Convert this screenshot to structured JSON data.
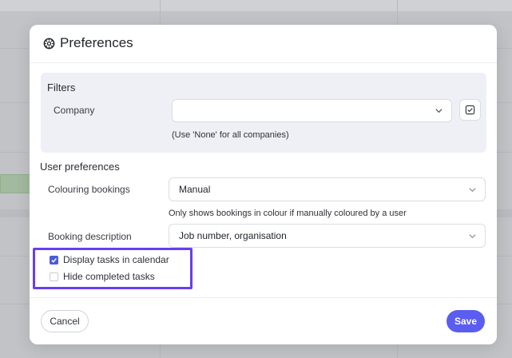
{
  "modal": {
    "title": "Preferences",
    "title_icon": "gear-icon"
  },
  "filters": {
    "heading": "Filters",
    "company": {
      "label": "Company",
      "value": "",
      "hint": "(Use 'None' for all companies)",
      "button_icon": "select-all-icon"
    }
  },
  "user_preferences": {
    "heading": "User preferences",
    "colouring_bookings": {
      "label": "Colouring bookings",
      "value": "Manual",
      "note": "Only shows bookings in colour if manually coloured by a user"
    },
    "booking_description": {
      "label": "Booking description",
      "value": "Job number, organisation"
    },
    "checkboxes": [
      {
        "label": "Display tasks in calendar",
        "checked": true
      },
      {
        "label": "Hide completed tasks",
        "checked": false
      }
    ]
  },
  "footer": {
    "cancel_label": "Cancel",
    "save_label": "Save"
  },
  "colors": {
    "accent": "#5a5df0",
    "highlight_border": "#6a3df0",
    "checkbox_checked": "#4a5bd8"
  }
}
